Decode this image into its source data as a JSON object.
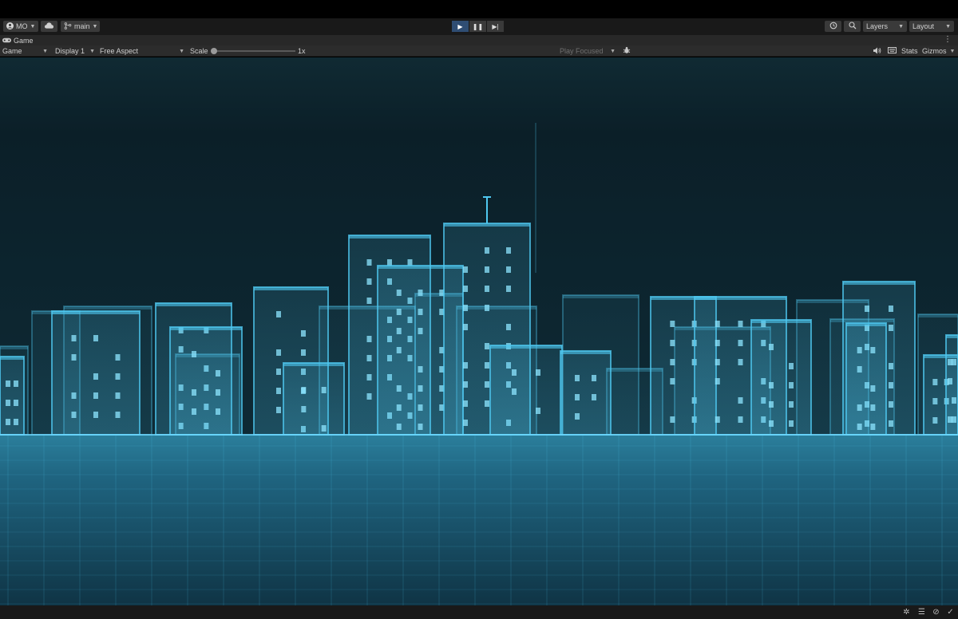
{
  "toolbar": {
    "account_label": "MO",
    "branch_label": "main",
    "layers_label": "Layers",
    "layout_label": "Layout"
  },
  "tab": {
    "title": "Game"
  },
  "gamebar": {
    "view_mode": "Game",
    "display": "Display 1",
    "aspect": "Free Aspect",
    "scale_label": "Scale",
    "scale_value": "1x",
    "play_mode": "Play Focused",
    "stats_label": "Stats",
    "gizmos_label": "Gizmos"
  },
  "icons": {
    "account": "account-icon",
    "cloud": "cloud-icon",
    "branch": "branch-icon",
    "play": "play-icon",
    "pause": "pause-icon",
    "step": "step-icon",
    "history": "history-icon",
    "search": "search-icon",
    "game_tab": "gamepad-icon",
    "bug": "bug-icon",
    "audio": "speaker-icon",
    "keyboard": "keyboard-icon"
  },
  "colors": {
    "hologram": "#4fc8f0",
    "accent_play": "#2f4d73",
    "sky": "#0d2630",
    "ground": "#1f5f78"
  }
}
